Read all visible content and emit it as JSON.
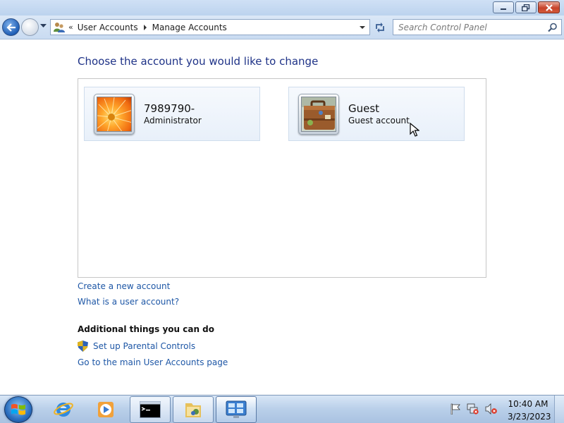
{
  "window": {
    "minimize_icon": "minimize-icon",
    "restore_icon": "restore-icon",
    "close_icon": "close-icon"
  },
  "nav": {
    "back_icon": "back-arrow-icon",
    "forward_icon": "forward-arrow-icon",
    "breadcrumb": {
      "overflow": "«",
      "items": [
        "User Accounts",
        "Manage Accounts"
      ]
    },
    "search_placeholder": "Search Control Panel"
  },
  "main": {
    "heading": "Choose the account you would like to change",
    "accounts": [
      {
        "name": "7989790-",
        "type": "Administrator",
        "picture": "orange-flower-picture"
      },
      {
        "name": "Guest",
        "type": "Guest account",
        "picture": "briefcase-picture"
      }
    ],
    "links": {
      "create": "Create a new account",
      "what_is": "What is a user account?"
    },
    "additional": {
      "heading": "Additional things you can do",
      "parental": "Set up Parental Controls",
      "main_page": "Go to the main User Accounts page"
    }
  },
  "taskbar": {
    "items": [
      "start-orb",
      "internet-explorer",
      "windows-media-player",
      "command-prompt",
      "windows-explorer",
      "control-panel"
    ],
    "clock": {
      "time": "10:40 AM",
      "date": "3/23/2023"
    }
  }
}
